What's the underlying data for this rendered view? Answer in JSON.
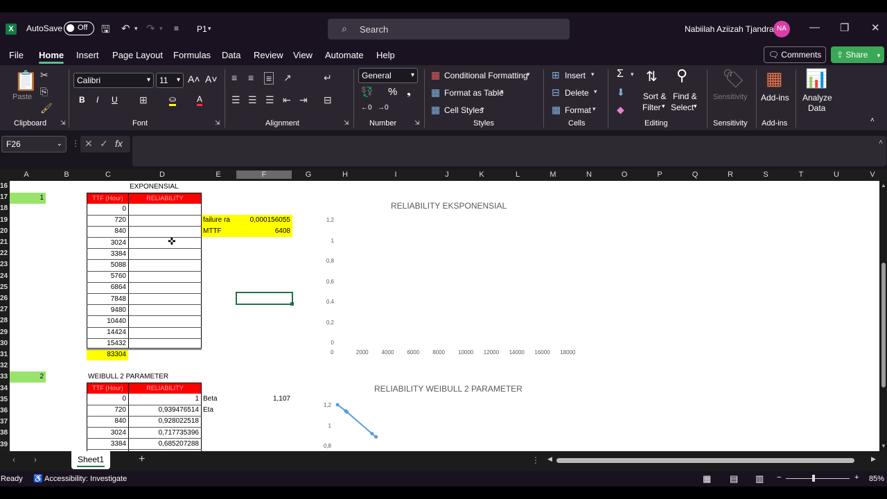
{
  "app": {
    "autosave_label": "AutoSave",
    "autosave_state": "Off",
    "doc_name": "P1",
    "search_placeholder": "Search",
    "user_name": "Nabiilah Aziizah Tjandra",
    "user_initials": "NA"
  },
  "menu": {
    "tabs": [
      "File",
      "Home",
      "Insert",
      "Page Layout",
      "Formulas",
      "Data",
      "Review",
      "View",
      "Automate",
      "Help"
    ],
    "comments": "Comments",
    "share": "Share"
  },
  "ribbon": {
    "clipboard": {
      "paste": "Paste",
      "label": "Clipboard"
    },
    "font": {
      "name": "Calibri",
      "size": "11",
      "label": "Font"
    },
    "alignment": {
      "label": "Alignment"
    },
    "number": {
      "format": "General",
      "label": "Number"
    },
    "styles": {
      "conditional": "Conditional Formatting",
      "table": "Format as Table",
      "cell": "Cell Styles",
      "label": "Styles"
    },
    "cells": {
      "insert": "Insert",
      "delete": "Delete",
      "format": "Format",
      "label": "Cells"
    },
    "editing": {
      "sort1": "Sort &",
      "sort2": "Filter",
      "find1": "Find &",
      "find2": "Select",
      "label": "Editing"
    },
    "sensitivity": {
      "btn": "Sensitivity",
      "label": "Sensitivity"
    },
    "addins": {
      "btn": "Add-ins",
      "label": "Add-ins"
    },
    "analyze": {
      "line1": "Analyze",
      "line2": "Data"
    }
  },
  "formula_bar": {
    "name_box": "F26",
    "fx": "fx"
  },
  "columns": [
    "A",
    "B",
    "C",
    "D",
    "E",
    "F",
    "G",
    "H",
    "I",
    "J",
    "K",
    "L",
    "M",
    "N",
    "O",
    "P",
    "Q",
    "R",
    "S",
    "T",
    "U",
    "V"
  ],
  "rows": [
    "16",
    "17",
    "18",
    "19",
    "20",
    "21",
    "22",
    "23",
    "24",
    "25",
    "26",
    "27",
    "28",
    "29",
    "30",
    "31",
    "32",
    "33",
    "34",
    "35",
    "36",
    "37",
    "38",
    "39"
  ],
  "sheet": {
    "exp_title": "EXPONENSIAL",
    "exp_index": "1",
    "hdr_ttf": "TTF (Hour)",
    "hdr_rel": "RELIABILITY",
    "exp_ttf": [
      "0",
      "720",
      "840",
      "3024",
      "3384",
      "5088",
      "5760",
      "6864",
      "7848",
      "9480",
      "10440",
      "14424",
      "15432"
    ],
    "exp_sum": "83304",
    "failure_rate_label": "failure ra",
    "failure_rate_value": "0,000156055",
    "mttf_label": "MTTF",
    "mttf_value": "6408",
    "weibull_title": "WEIBULL 2 PARAMETER",
    "weibull_index": "2",
    "weibull_ttf": [
      "0",
      "720",
      "840",
      "3024",
      "3384"
    ],
    "weibull_rel": [
      "1",
      "0,939476514",
      "0,928022518",
      "0,717735396",
      "0,685207288"
    ],
    "beta_label": "Beta",
    "beta_value": "1,107",
    "eta_label": "Eta"
  },
  "chart_data": [
    {
      "type": "scatter",
      "title": "RELIABILITY EKSPONENSIAL",
      "y_ticks": [
        "1,2",
        "1",
        "0,8",
        "0,6",
        "0,4",
        "0,2",
        "0"
      ],
      "x_ticks": [
        "0",
        "2000",
        "4000",
        "6000",
        "8000",
        "10000",
        "12000",
        "14000",
        "16000",
        "18000"
      ],
      "series": []
    },
    {
      "type": "line",
      "title": "RELIABILITY WEIBULL 2 PARAMETER",
      "y_ticks": [
        "1,2",
        "1",
        "0,8"
      ],
      "series": [
        {
          "x": [
            0,
            720,
            840,
            3024,
            3384
          ],
          "values": [
            1,
            0.939476514,
            0.928022518,
            0.717735396,
            0.685207288
          ]
        }
      ],
      "line_color": "#5b9bd5"
    }
  ],
  "tabs": {
    "sheet1": "Sheet1",
    "add": "+"
  },
  "status": {
    "ready": "Ready",
    "accessibility": "Accessibility: Investigate",
    "zoom": "85%"
  }
}
